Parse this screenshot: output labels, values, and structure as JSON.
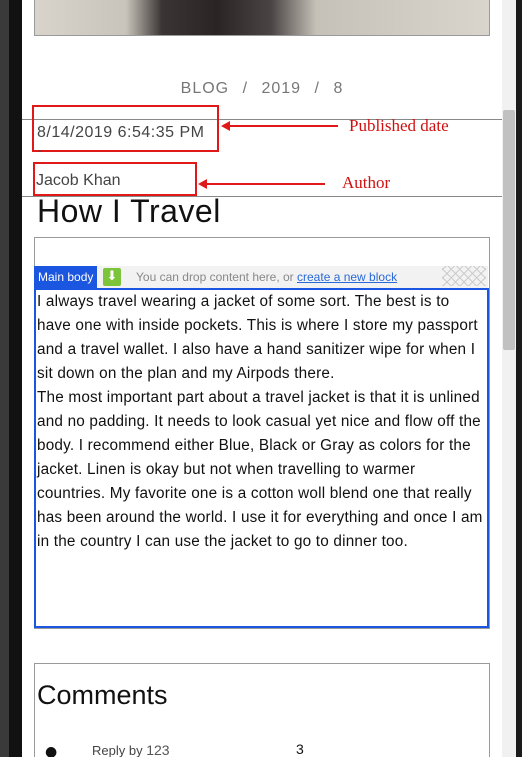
{
  "breadcrumb": {
    "items": [
      "BLOG",
      "2019",
      "8"
    ],
    "separator": "/"
  },
  "post": {
    "published_date": "8/14/2019 6:54:35 PM",
    "dash": "-",
    "author": "Jacob Khan",
    "title": "How I Travel",
    "paragraphs": [
      "I always travel wearing a jacket of some sort. The best is to have one with inside pockets. This is where I store my passport and a travel wallet. I also have a hand sanitizer wipe for when I sit down on the plan and my Airpods there.",
      "The most important part about a travel jacket is that it is unlined and no padding. It needs to look casual yet nice and flow off the body. I recommend either Blue, Black or Gray as colors for the jacket. Linen is okay but not when travelling to warmer countries. My favorite one is a cotton woll blend one that really has been around the world. I use it for everything and once I am in the country I can use the jacket to go to dinner too."
    ]
  },
  "editor": {
    "region_tag": "Main body",
    "drop_hint": "You can drop content here, or",
    "create_link": "create a new block",
    "drop_icon": "download-arrow-icon",
    "accent_color": "#1b56e0"
  },
  "annotations": {
    "published_label": "Published date",
    "author_label": "Author",
    "color": "#e01818"
  },
  "comments": {
    "title": "Comments",
    "items": [
      {
        "prefix": "Reply by",
        "user": "123",
        "count": "3"
      }
    ]
  }
}
